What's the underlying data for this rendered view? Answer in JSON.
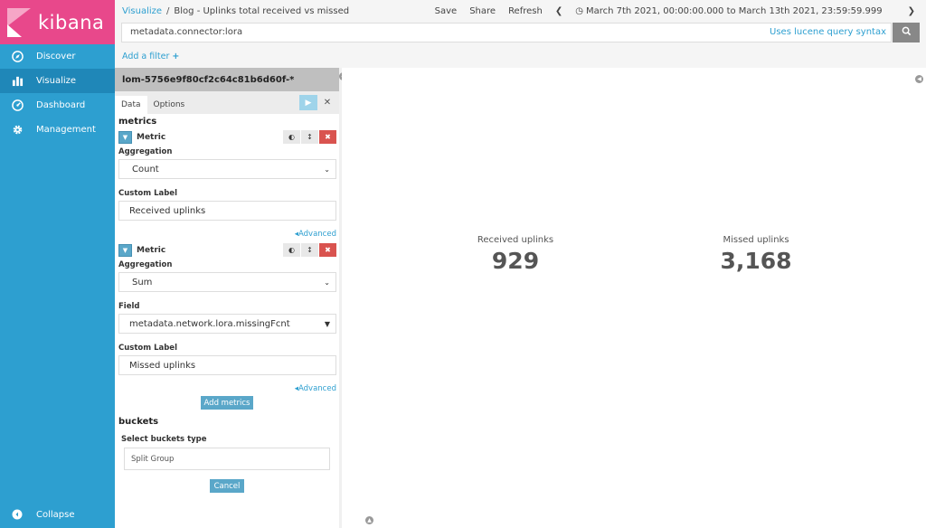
{
  "sidebar": {
    "logo_text": "kibana",
    "items": [
      {
        "label": "Discover",
        "icon": "compass-icon"
      },
      {
        "label": "Visualize",
        "icon": "bar-chart-icon"
      },
      {
        "label": "Dashboard",
        "icon": "dashboard-icon"
      },
      {
        "label": "Management",
        "icon": "gear-icon"
      }
    ],
    "collapse_label": "Collapse"
  },
  "topbar": {
    "breadcrumb_link": "Visualize",
    "breadcrumb_sep": "/",
    "title": "Blog - Uplinks total received vs missed",
    "save": "Save",
    "share": "Share",
    "refresh": "Refresh",
    "time_range": "March 7th 2021, 00:00:00.000 to March 13th 2021, 23:59:59.999"
  },
  "query": {
    "value": "metadata.connector:lora",
    "syntax_link": "Uses lucene query syntax"
  },
  "filter": {
    "add_label": "Add a filter"
  },
  "editor": {
    "index_pattern": "lom-5756e9f80cf2c64c81b6d60f-*",
    "tabs": [
      "Data",
      "Options"
    ],
    "metrics_title": "metrics",
    "metric1": {
      "label": "Metric",
      "aggregation_label": "Aggregation",
      "aggregation": "Count",
      "custom_label_title": "Custom Label",
      "custom_label": "Received uplinks",
      "advanced": "Advanced"
    },
    "metric2": {
      "label": "Metric",
      "aggregation_label": "Aggregation",
      "aggregation": "Sum",
      "field_label": "Field",
      "field": "metadata.network.lora.missingFcnt",
      "custom_label_title": "Custom Label",
      "custom_label": "Missed uplinks",
      "advanced": "Advanced"
    },
    "add_metrics": "Add metrics",
    "buckets_title": "buckets",
    "buckets_type_label": "Select buckets type",
    "buckets_type": "Split Group",
    "cancel": "Cancel"
  },
  "visualization": {
    "metrics": [
      {
        "label": "Received uplinks",
        "value": "929"
      },
      {
        "label": "Missed uplinks",
        "value": "3,168"
      }
    ]
  },
  "colors": {
    "sidebar": "#2d9fd0",
    "sidebar_active": "#1f87b8",
    "logo_bg": "#e8488b",
    "link": "#2d9fd0",
    "danger": "#d9534f"
  }
}
